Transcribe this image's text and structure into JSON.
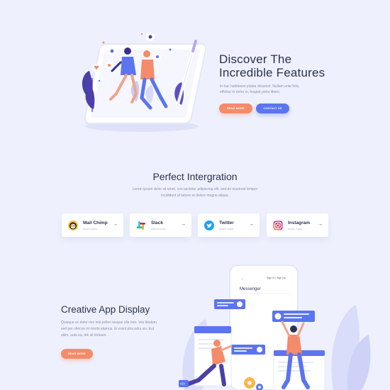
{
  "hero": {
    "title_line1": "Discover The",
    "title_line2": "Incredible Features",
    "desc_line1": "In hac habitasse platea dictumst. Nullam ante felis,",
    "desc_line2": "efficitur in tortor in, feugiat porta libero.",
    "btn_read_more": "READ MORE",
    "btn_contact": "CONTACT US"
  },
  "integration": {
    "title": "Perfect Intergration",
    "desc_line1": "Lorem ipsum dolor sit amet, con sectetur adipiscing elit, sed do eiusmod tempor",
    "desc_line2": "incididunt ut labore et dolore magna aliqua.",
    "cards": [
      {
        "name": "Mail Chimp",
        "sub": "SEND EMAIL",
        "icon": "mailchimp-icon"
      },
      {
        "name": "Slack",
        "sub": "MESSAGING",
        "icon": "slack-icon"
      },
      {
        "name": "Twitter",
        "sub": "NEWS FEED",
        "icon": "twitter-icon"
      },
      {
        "name": "Instagram",
        "sub": "NEWS FEED",
        "icon": "instagram-icon"
      }
    ],
    "arrow": "→"
  },
  "app": {
    "title": "Creative App Display",
    "desc_line1": "Quisque ac dolor nec nisl pellen tesque ulla mer. Ves tibulum",
    "desc_line2": "sed per ultrices mi morbi etamus. Ei erant pha edru vis. Eut",
    "desc_line3": "aliim, auta ea, tek sit timeam.",
    "btn_read_more": "READ MORE",
    "phone": {
      "signin": "Sign In | Sign Up",
      "header": "Messenger"
    }
  },
  "colors": {
    "background": "#eef1fd",
    "orange": "#f48b6a",
    "blue": "#5b74ef",
    "purple": "#4b3fa8"
  }
}
